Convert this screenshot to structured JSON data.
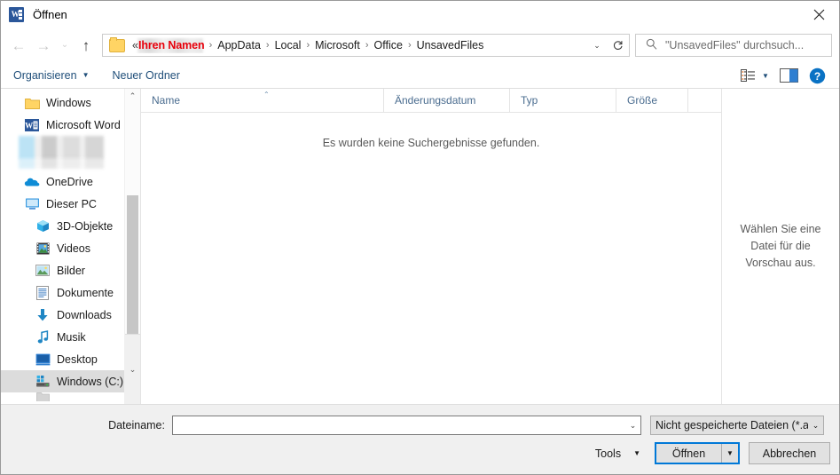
{
  "window": {
    "title": "Öffnen",
    "app_icon": "word-icon",
    "close_label": "✕"
  },
  "navigation": {
    "back_icon": "arrow-left-icon",
    "forward_icon": "arrow-right-icon",
    "recent_icon": "chevron-down-icon",
    "up_icon": "arrow-up-icon",
    "breadcrumb": {
      "folder_icon": "folder-icon",
      "overflow": "«",
      "redacted_name": "Ihren Namen",
      "items": [
        "AppData",
        "Local",
        "Microsoft",
        "Office",
        "UnsavedFiles"
      ],
      "separator": "›",
      "dropdown_icon": "chevron-down-icon"
    },
    "refresh_icon": "refresh-icon",
    "search": {
      "icon": "search-icon",
      "placeholder": "\"UnsavedFiles\" durchsuch..."
    }
  },
  "toolbar": {
    "organize_label": "Organisieren",
    "organize_caret": "▼",
    "new_folder_label": "Neuer Ordner",
    "view_icon": "view-layout-icon",
    "view_caret": "▼",
    "pane_icon": "preview-pane-icon",
    "help_icon": "help-icon"
  },
  "sidebar": {
    "items": [
      {
        "label": "Windows",
        "icon": "folder-icon",
        "indent": false,
        "selected": false
      },
      {
        "label": "Microsoft Word",
        "icon": "word-icon",
        "indent": false,
        "selected": false
      },
      {
        "label": "",
        "icon": "redacted",
        "indent": false,
        "selected": false
      },
      {
        "label": "OneDrive",
        "icon": "onedrive-icon",
        "indent": false,
        "selected": false
      },
      {
        "label": "Dieser PC",
        "icon": "this-pc-icon",
        "indent": false,
        "selected": false
      },
      {
        "label": "3D-Objekte",
        "icon": "3d-objects-icon",
        "indent": true,
        "selected": false
      },
      {
        "label": "Videos",
        "icon": "videos-icon",
        "indent": true,
        "selected": false
      },
      {
        "label": "Bilder",
        "icon": "pictures-icon",
        "indent": true,
        "selected": false
      },
      {
        "label": "Dokumente",
        "icon": "documents-icon",
        "indent": true,
        "selected": false
      },
      {
        "label": "Downloads",
        "icon": "downloads-icon",
        "indent": true,
        "selected": false
      },
      {
        "label": "Musik",
        "icon": "music-icon",
        "indent": true,
        "selected": false
      },
      {
        "label": "Desktop",
        "icon": "desktop-icon",
        "indent": true,
        "selected": false
      },
      {
        "label": "Windows (C:)",
        "icon": "drive-icon",
        "indent": true,
        "selected": true
      }
    ],
    "scroll_up_icon": "chevron-up-icon",
    "scroll_down_icon": "chevron-down-icon"
  },
  "filelist": {
    "columns": [
      {
        "key": "name",
        "label": "Name",
        "sorted": "asc"
      },
      {
        "key": "date",
        "label": "Änderungsdatum",
        "sorted": ""
      },
      {
        "key": "type",
        "label": "Typ",
        "sorted": ""
      },
      {
        "key": "size",
        "label": "Größe",
        "sorted": ""
      }
    ],
    "sort_caret": "⌃",
    "rows": [],
    "empty_message": "Es wurden keine Suchergebnisse gefunden."
  },
  "preview": {
    "message": "Wählen Sie eine Datei für die Vorschau aus."
  },
  "bottom": {
    "filename_label": "Dateiname:",
    "filename_value": "",
    "filename_caret": "⌄",
    "filter_value": "Nicht gespeicherte Dateien (*.a",
    "filter_caret": "⌄",
    "tools_label": "Tools",
    "tools_caret": "▼",
    "open_label": "Öffnen",
    "open_caret": "▼",
    "cancel_label": "Abbrechen"
  },
  "colors": {
    "accent": "#0078d7",
    "toolbar_link": "#1f4e79",
    "redacted_name": "#e8000b",
    "column_header": "#4a6c8f",
    "selection": "#dcdcdc"
  }
}
